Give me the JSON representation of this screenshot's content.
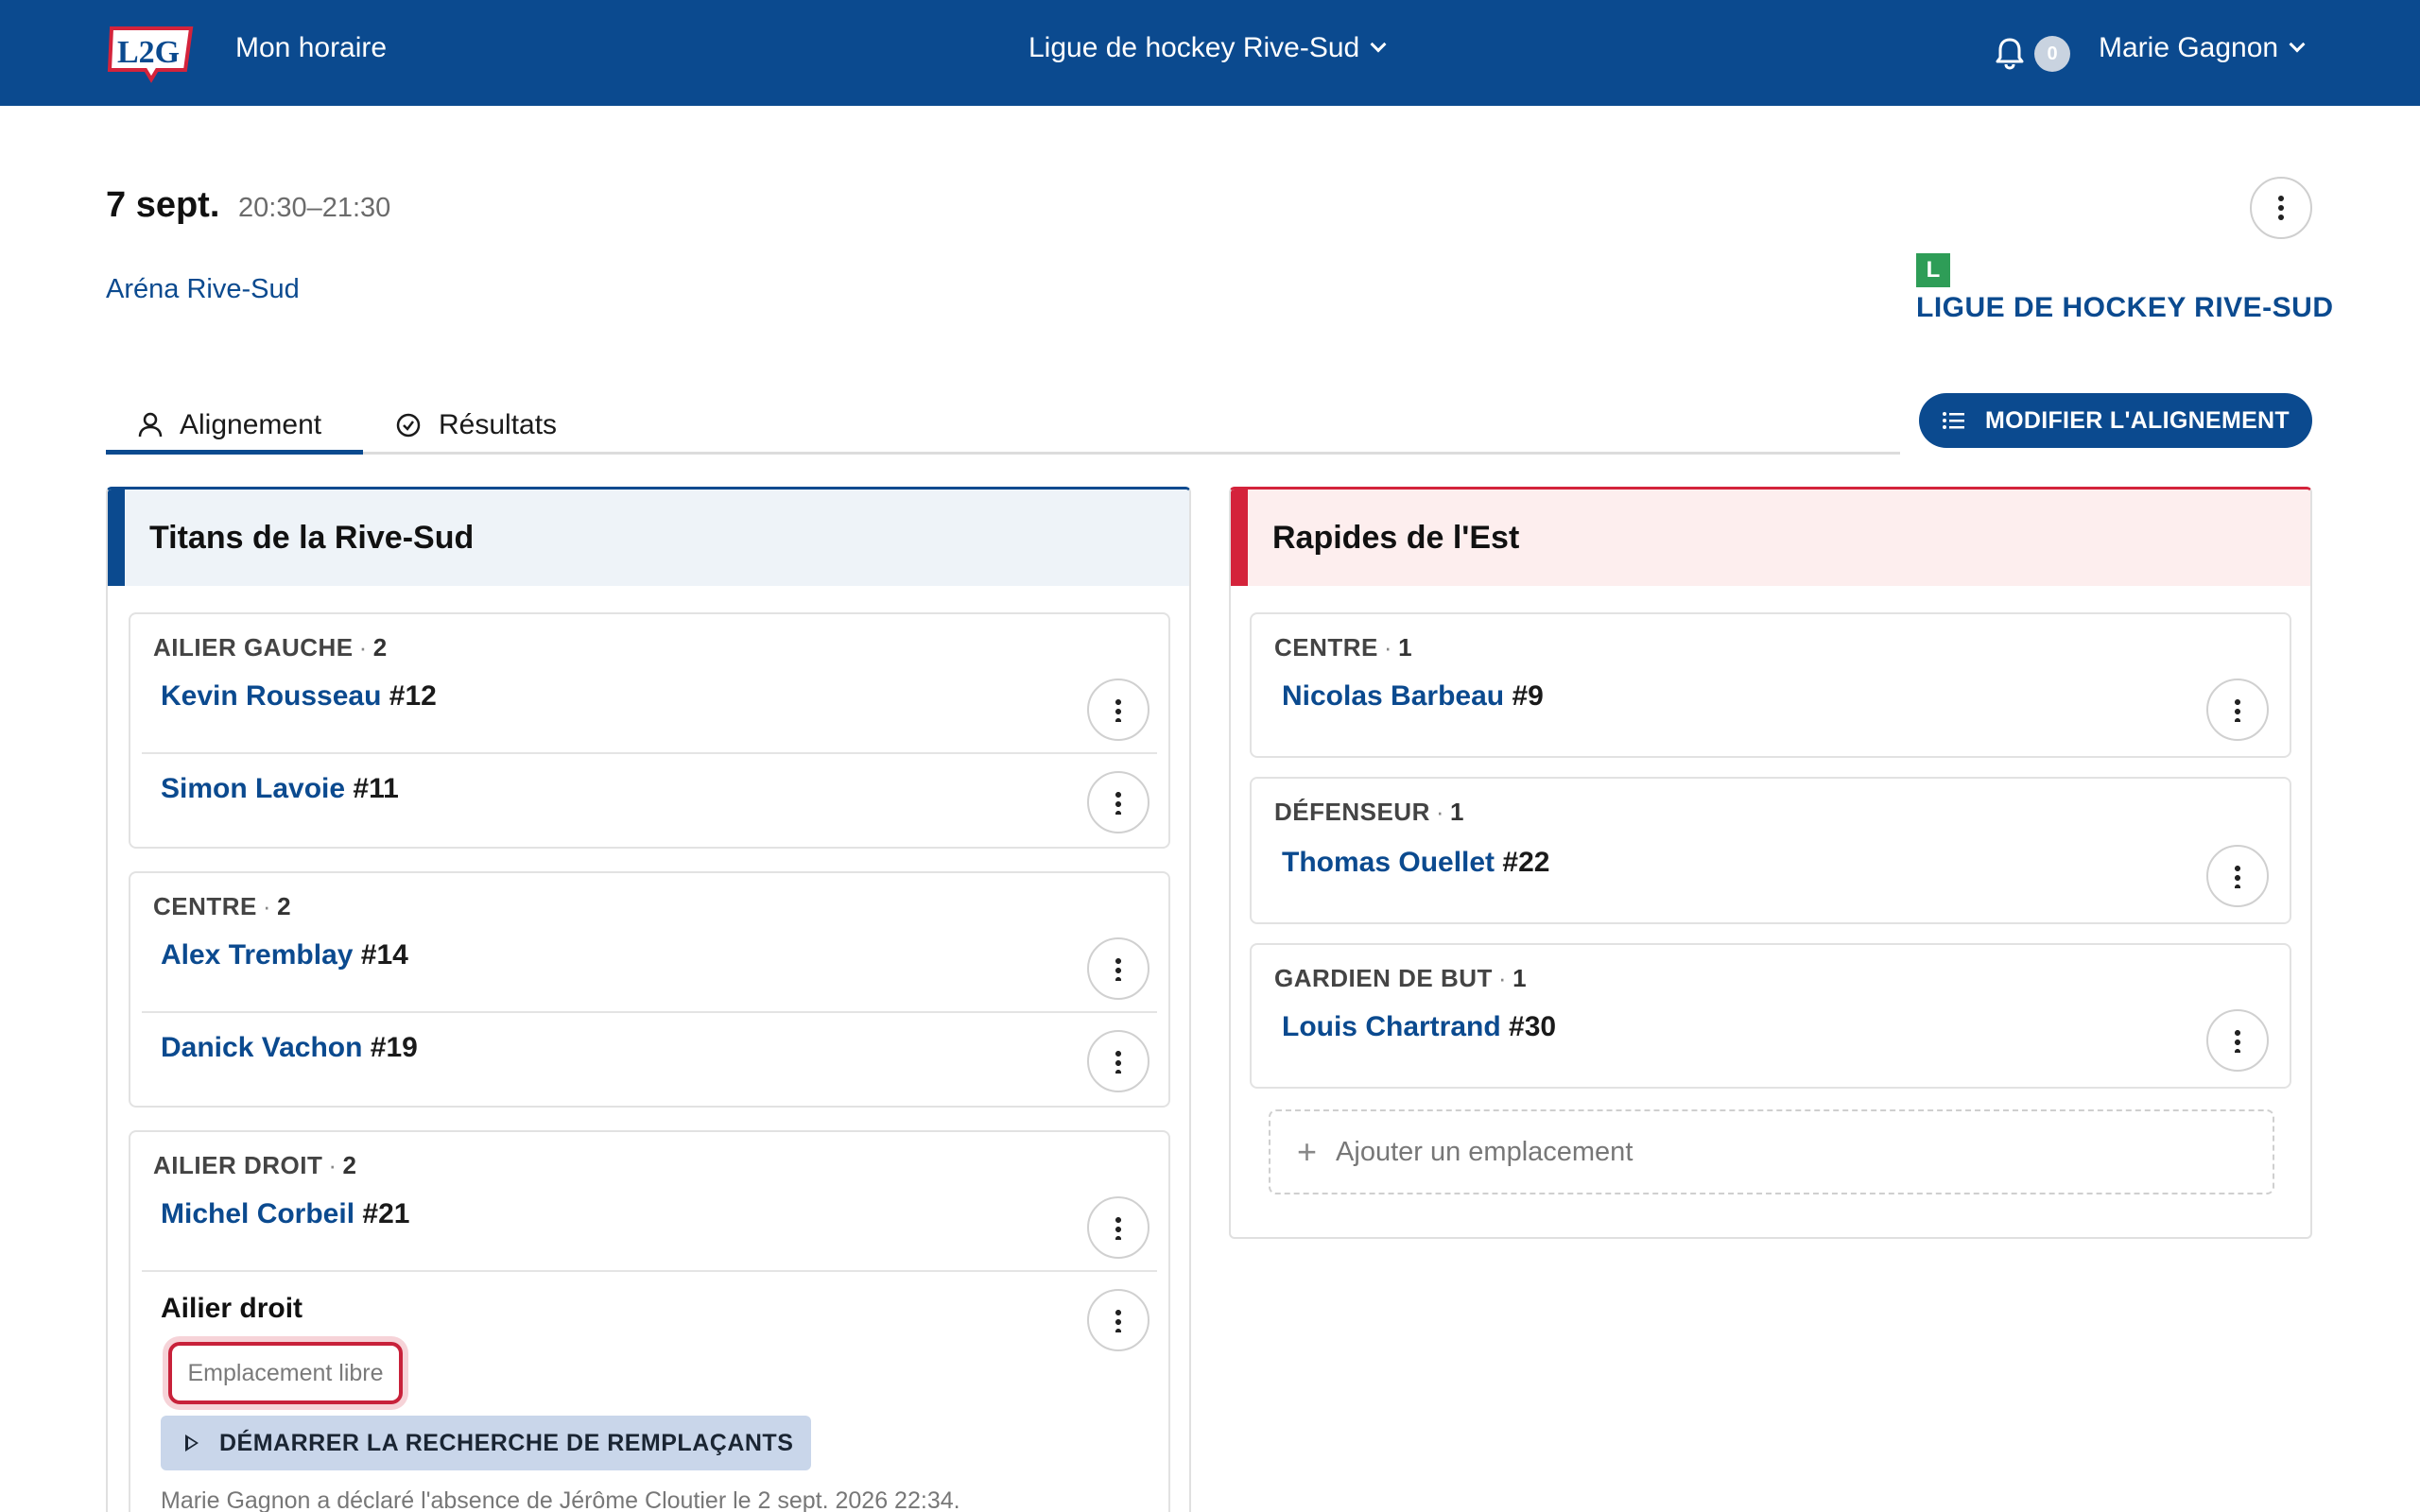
{
  "header": {
    "logo_text": "L2G",
    "nav_title": "Mon horaire",
    "league_selector": "Ligue de hockey Rive-Sud",
    "notification_count": "0",
    "user_name": "Marie Gagnon"
  },
  "event": {
    "date": "7 sept.",
    "time": "20:30–21:30",
    "venue": "Aréna Rive-Sud",
    "league_logo_letter": "L",
    "league_name": "LIGUE DE HOCKEY RIVE-SUD"
  },
  "tabs": [
    {
      "label": "Alignement",
      "icon": "person-icon",
      "active": true
    },
    {
      "label": "Résultats",
      "icon": "check-circle-icon",
      "active": false
    }
  ],
  "modify_button": "MODIFIER L'ALIGNEMENT",
  "home_team": {
    "name": "Titans de la Rive-Sud",
    "color": "#0b4a8f",
    "groups": [
      {
        "position": "AILIER GAUCHE",
        "count": "2",
        "players": [
          {
            "name": "Kevin Rousseau",
            "number": "#12"
          },
          {
            "name": "Simon Lavoie",
            "number": "#11"
          }
        ]
      },
      {
        "position": "CENTRE",
        "count": "2",
        "players": [
          {
            "name": "Alex Tremblay",
            "number": "#14"
          },
          {
            "name": "Danick Vachon",
            "number": "#19"
          }
        ]
      },
      {
        "position": "AILIER DROIT",
        "count": "2",
        "players": [
          {
            "name": "Michel Corbeil",
            "number": "#21"
          }
        ],
        "open_slot": {
          "title": "Ailier droit",
          "status": "Emplacement libre",
          "search_button": "DÉMARRER LA RECHERCHE DE REMPLAÇANTS",
          "note": "Marie Gagnon a déclaré l'absence de Jérôme Cloutier le 2 sept. 2026 22:34."
        }
      }
    ]
  },
  "away_team": {
    "name": "Rapides de l'Est",
    "color": "#d4233b",
    "groups": [
      {
        "position": "CENTRE",
        "count": "1",
        "players": [
          {
            "name": "Nicolas Barbeau",
            "number": "#9"
          }
        ]
      },
      {
        "position": "DÉFENSEUR",
        "count": "1",
        "players": [
          {
            "name": "Thomas Ouellet",
            "number": "#22"
          }
        ]
      },
      {
        "position": "GARDIEN DE BUT",
        "count": "1",
        "players": [
          {
            "name": "Louis Chartrand",
            "number": "#30"
          }
        ]
      }
    ],
    "add_slot_label": "Ajouter un emplacement"
  }
}
